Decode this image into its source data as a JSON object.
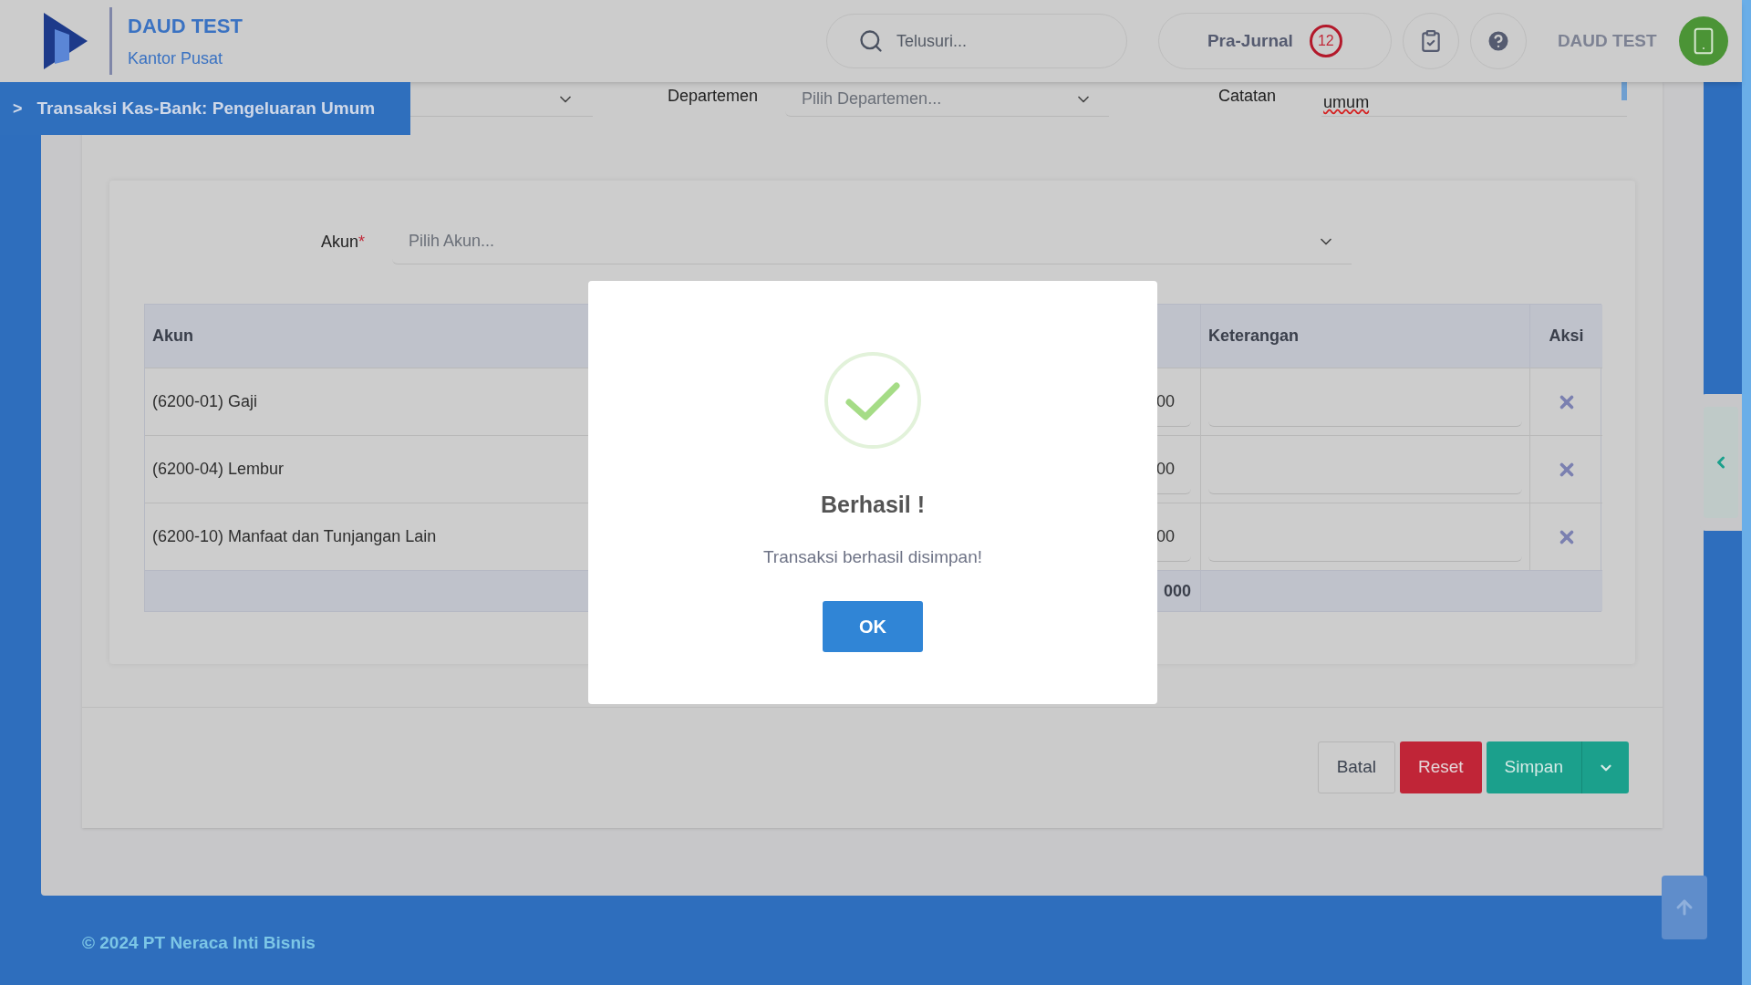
{
  "header": {
    "brand": "DAUD TEST",
    "branch": "Kantor Pusat",
    "search": {
      "placeholder": "Telusuri..."
    },
    "pre_journal": {
      "label": "Pra-Jurnal",
      "count": "12"
    },
    "user": "DAUD TEST"
  },
  "breadcrumb": {
    "marker": ">",
    "title": "Transaksi Kas-Bank: Pengeluaran Umum"
  },
  "filters": {
    "department": {
      "label": "Departemen",
      "placeholder": "Pilih Departemen..."
    },
    "note": {
      "label": "Catatan",
      "value": "umum"
    }
  },
  "account_picker": {
    "label": "Akun",
    "required_mark": "*",
    "placeholder": "Pilih Akun..."
  },
  "table": {
    "columns": {
      "account": "Akun",
      "note": "Keterangan",
      "action": "Aksi"
    },
    "rows": [
      {
        "account": "(6200-01) Gaji",
        "amount": "00"
      },
      {
        "account": "(6200-04) Lembur",
        "amount": "00"
      },
      {
        "account": "(6200-10) Manfaat dan Tunjangan Lain",
        "amount": "00"
      }
    ],
    "total": "000"
  },
  "buttons": [
    {
      "label": "Batal",
      "kind": "default"
    },
    {
      "label": "Reset",
      "kind": "danger"
    },
    {
      "label": "Simpan",
      "kind": "split"
    }
  ],
  "dialog": {
    "title": "Berhasil !",
    "message": "Transaksi berhasil disimpan!",
    "button": "OK"
  },
  "footer": "© 2024 PT Neraca Inti Bisnis"
}
